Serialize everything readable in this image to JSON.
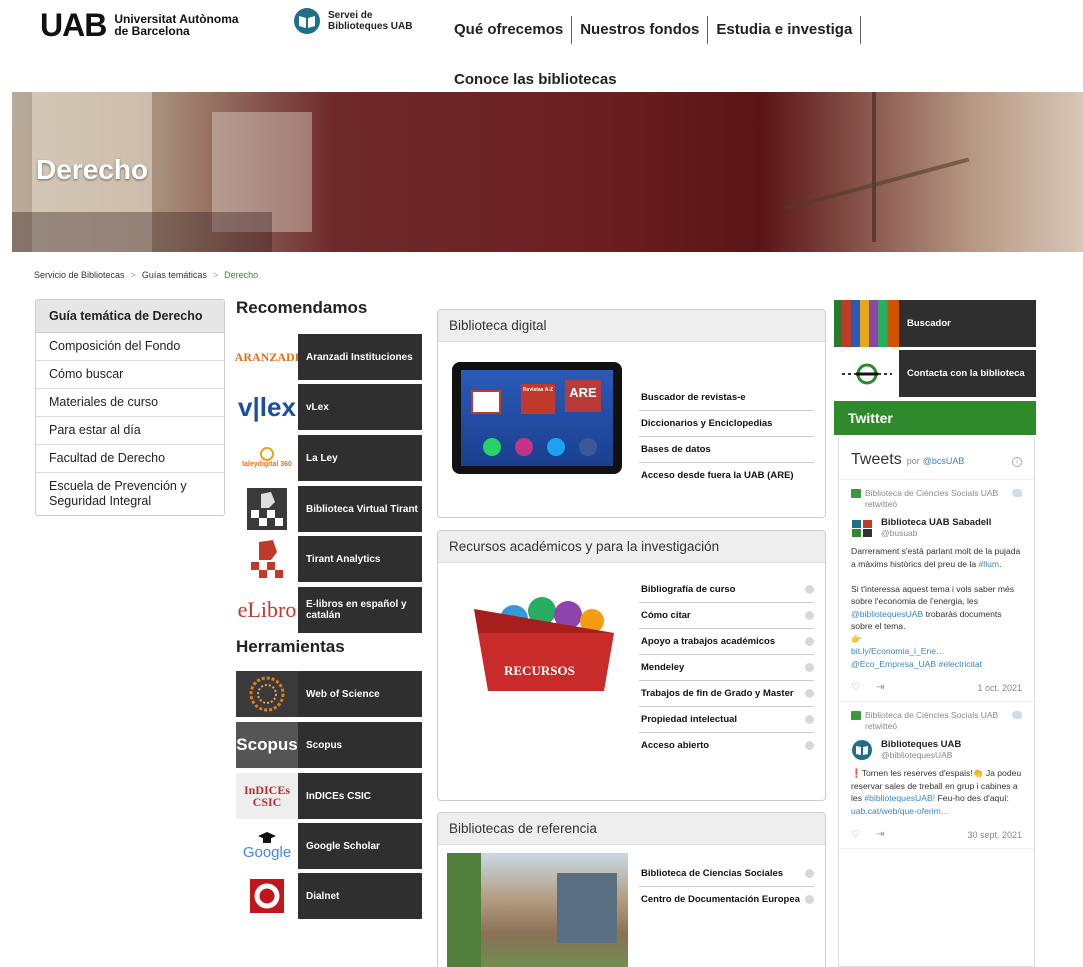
{
  "header": {
    "uab_mark": "UAB",
    "uab_name_line1": "Universitat Autònoma",
    "uab_name_line2": "de Barcelona",
    "library_line1": "Servei de",
    "library_line2": "Biblioteques UAB",
    "nav": [
      "Qué ofrecemos",
      "Nuestros fondos",
      "Estudia e investiga"
    ],
    "nav_row2": "Conoce las bibliotecas"
  },
  "hero": {
    "title": "Derecho"
  },
  "breadcrumb": {
    "items": [
      "Servicio de Bibliotecas",
      "Guías temáticas"
    ],
    "current": "Derecho",
    "separator": ">"
  },
  "leftmenu": {
    "title": "Guía temática de Derecho",
    "items": [
      "Composición del Fondo",
      "Cómo buscar",
      "Materiales de curso",
      "Para estar al día",
      "Facultad de Derecho",
      "Escuela de Prevención y Seguridad Integral"
    ]
  },
  "recommended": {
    "title": "Recomendamos",
    "logos": [
      "ARANZADI",
      "v|lex",
      "laleydigital 360",
      "",
      "",
      "eLibro"
    ],
    "items": [
      "Aranzadi Instituciones",
      "vLex",
      "La Ley",
      "Biblioteca Virtual Tirant",
      "Tirant Analytics",
      "E-libros en español y catalán"
    ]
  },
  "tools": {
    "title": "Herramientas",
    "logos": [
      "",
      "Scopus",
      "InDICEs CSIC",
      "Google",
      ""
    ],
    "items": [
      "Web of Science",
      "Scopus",
      "InDICEs CSIC",
      "Google Scholar",
      "Dialnet"
    ]
  },
  "digital": {
    "title": "Biblioteca digital",
    "tablet_labels": [
      "Revistas A-Z",
      "ARE"
    ],
    "links": [
      "Buscador de revistas-e",
      "Diccionarios y Enciclopedias",
      "Bases de datos",
      "Acceso desde fuera la UAB (ARE)"
    ]
  },
  "academic": {
    "title": "Recursos académicos y para la investigación",
    "chest_label": "RECURSOS",
    "links": [
      "Bibliografía de curso",
      "Cómo citar",
      "Apoyo a trabajos académicos",
      "Mendeley",
      "Trabajos de fin de Grado y Master",
      "Propiedad intelectual",
      "Acceso abierto"
    ]
  },
  "reference": {
    "title": "Bibliotecas de referencia",
    "links": [
      "Biblioteca de Ciencias Sociales",
      "Centro de Documentación Europea"
    ]
  },
  "right": {
    "buscador": "Buscador",
    "contacta": "Contacta con la biblioteca",
    "twitter": "Twitter"
  },
  "tweets_widget": {
    "title": "Tweets",
    "by": "por",
    "handle": "@bcsUAB",
    "tweets": [
      {
        "retweeted_by": "Biblioteca de Ciències Socials UAB retwitteó",
        "author": "Biblioteca UAB Sabadell",
        "handle": "@busuab",
        "text_1": "Darrerament s'està parlant molt de la pujada a màxims històrics del preu de la",
        "tag_1": "#llum",
        "text_2": "Si t'interessa aquest tema i vols saber més sobre l'economia de l'energia, les",
        "mention": "@bibliotequesUAB",
        "text_3": "trobaràs documents sobre el tema.",
        "link": "bit.ly/Economia_i_Ene… @Eco_Empresa_UAB #electricitat",
        "date": "1 oct. 2021"
      },
      {
        "retweeted_by": "Biblioteca de Ciències Socials UAB retwitteó",
        "author": "Biblioteques UAB",
        "handle": "@bibliotequesUAB",
        "text_1": "❗Tornen les reserves d'espais!👏 Ja podeu reservar sales de treball en grup i cabines a les",
        "tag_1": "#bibliotequesUAB!",
        "text_2": "Feu-ho des d'aquí:",
        "link": "uab.cat/web/que-oferim…",
        "date": "30 sept. 2021"
      }
    ]
  },
  "colors": {
    "twitter_green": "#2f8a2b",
    "tile_dark": "#2f2f2f",
    "link_blue": "#3b88c3",
    "breadcrumb_green": "#3a8a3a"
  }
}
